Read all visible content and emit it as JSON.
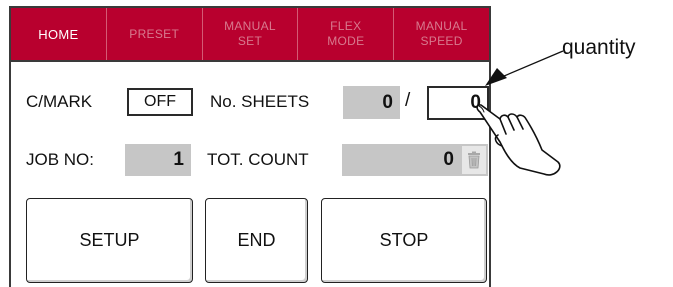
{
  "tabs": [
    {
      "label": "HOME",
      "active": true
    },
    {
      "label": "PRESET",
      "active": false
    },
    {
      "label": "MANUAL\nSET",
      "active": false
    },
    {
      "label": "FLEX\nMODE",
      "active": false
    },
    {
      "label": "MANUAL\nSPEED",
      "active": false
    }
  ],
  "cmark": {
    "label": "C/MARK",
    "value": "OFF"
  },
  "sheets": {
    "label": "No. SHEETS",
    "counted": "0",
    "separator": "/",
    "quantity": "0"
  },
  "job": {
    "label": "JOB NO:",
    "value": "1"
  },
  "total": {
    "label": "TOT. COUNT",
    "value": "0",
    "reset_icon": "trash-can-icon"
  },
  "buttons": {
    "setup": "SETUP",
    "end": "END",
    "stop": "STOP"
  },
  "annotation": {
    "text": "quantity",
    "pointer_icon": "pointing-hand-icon"
  },
  "colors": {
    "tab_bar": "#b8002e",
    "tab_active_text": "#ffffff",
    "tab_inactive_text": "#d8798e",
    "display_fill": "#c6c6c6"
  }
}
